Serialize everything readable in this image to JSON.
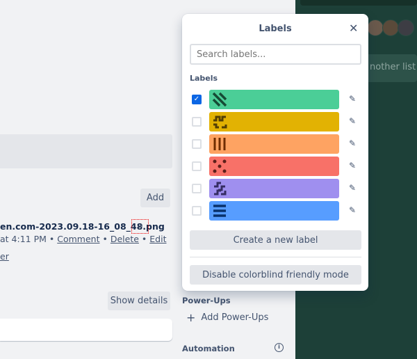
{
  "background": {
    "add_label": "Add",
    "filename": "en.com-2023.09.18-16_08_48.png",
    "open_icon": "arrow-up-right-icon",
    "meta_time": "at 4:11 PM",
    "comment": "Comment",
    "delete": "Delete",
    "edit": "Edit",
    "sep": "•",
    "partial_link": "er",
    "show_details": "Show details"
  },
  "sidebar": {
    "powerups_heading": "Power-Ups",
    "add_powerups": "Add Power-Ups",
    "automation_heading": "Automation"
  },
  "board": {
    "another_list": "nother list"
  },
  "popup": {
    "title": "Labels",
    "search_placeholder": "Search labels...",
    "section": "Labels",
    "labels": [
      {
        "color": "#4bce97",
        "checked": true,
        "pattern": "diagonal-stripes"
      },
      {
        "color": "#e2b203",
        "checked": false,
        "pattern": "waves"
      },
      {
        "color": "#fea362",
        "checked": false,
        "pattern": "vertical-bars"
      },
      {
        "color": "#f87168",
        "checked": false,
        "pattern": "dots"
      },
      {
        "color": "#9f8fef",
        "checked": false,
        "pattern": "zigzag"
      },
      {
        "color": "#579dff",
        "checked": false,
        "pattern": "horizontal-bars"
      }
    ],
    "create": "Create a new label",
    "disable_colorblind": "Disable colorblind friendly mode"
  }
}
